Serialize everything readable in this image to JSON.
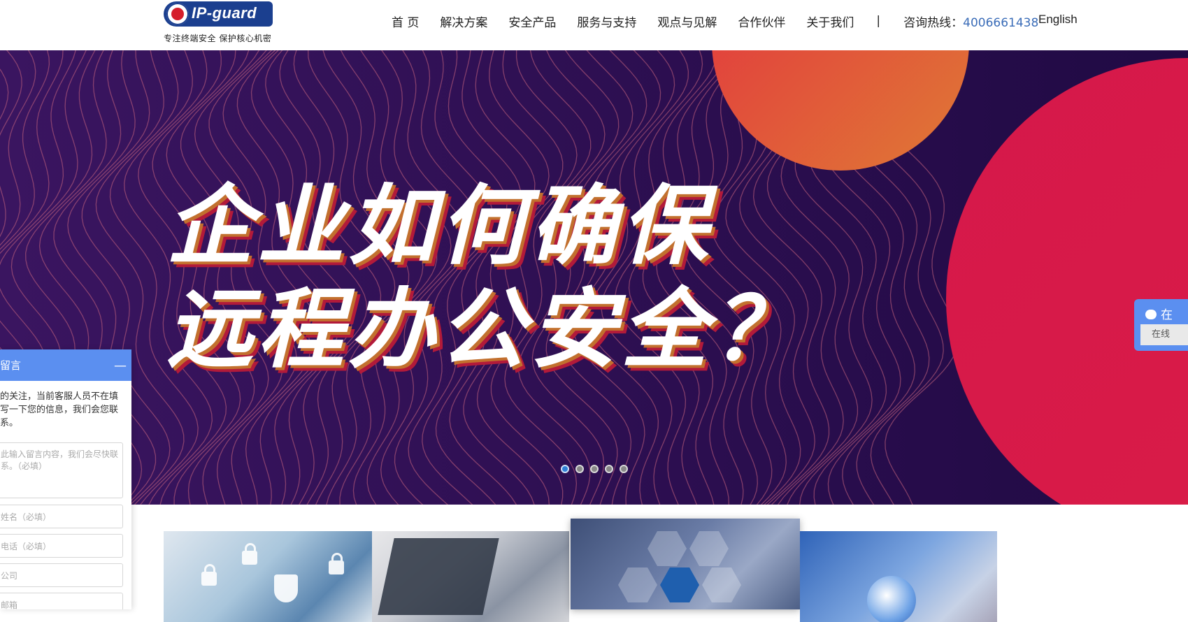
{
  "header": {
    "logo_text": "IP-guard",
    "slogan": "专注终端安全 保护核心机密",
    "nav": [
      "首 页",
      "解决方案",
      "安全产品",
      "服务与支持",
      "观点与见解",
      "合作伙伴",
      "关于我们"
    ],
    "separator": "|",
    "hotline_label": "咨询热线：",
    "hotline_number": "4006661438",
    "language": "English"
  },
  "banner": {
    "title_line1": "企业如何确保",
    "title_line2": "远程办公安全？",
    "slides": 5,
    "active_slide": 1
  },
  "chat_tab": {
    "label": "在",
    "button": "在线"
  },
  "message_panel": {
    "title": "留言",
    "notice": "的关注，当前客服人员不在填写一下您的信息，我们会您联系。",
    "content_placeholder": "此输入留言内容，我们会尽快联系。（必填）",
    "name_placeholder": "姓名（必填）",
    "phone_placeholder": "电话（必填）",
    "company_placeholder": "公司",
    "email_placeholder": "邮箱"
  },
  "colors": {
    "brand_blue": "#1b3f8f",
    "accent_blue": "#5b8ff0",
    "hotline_blue": "#3b6db8",
    "banner_bg": "#2a0d4b"
  }
}
